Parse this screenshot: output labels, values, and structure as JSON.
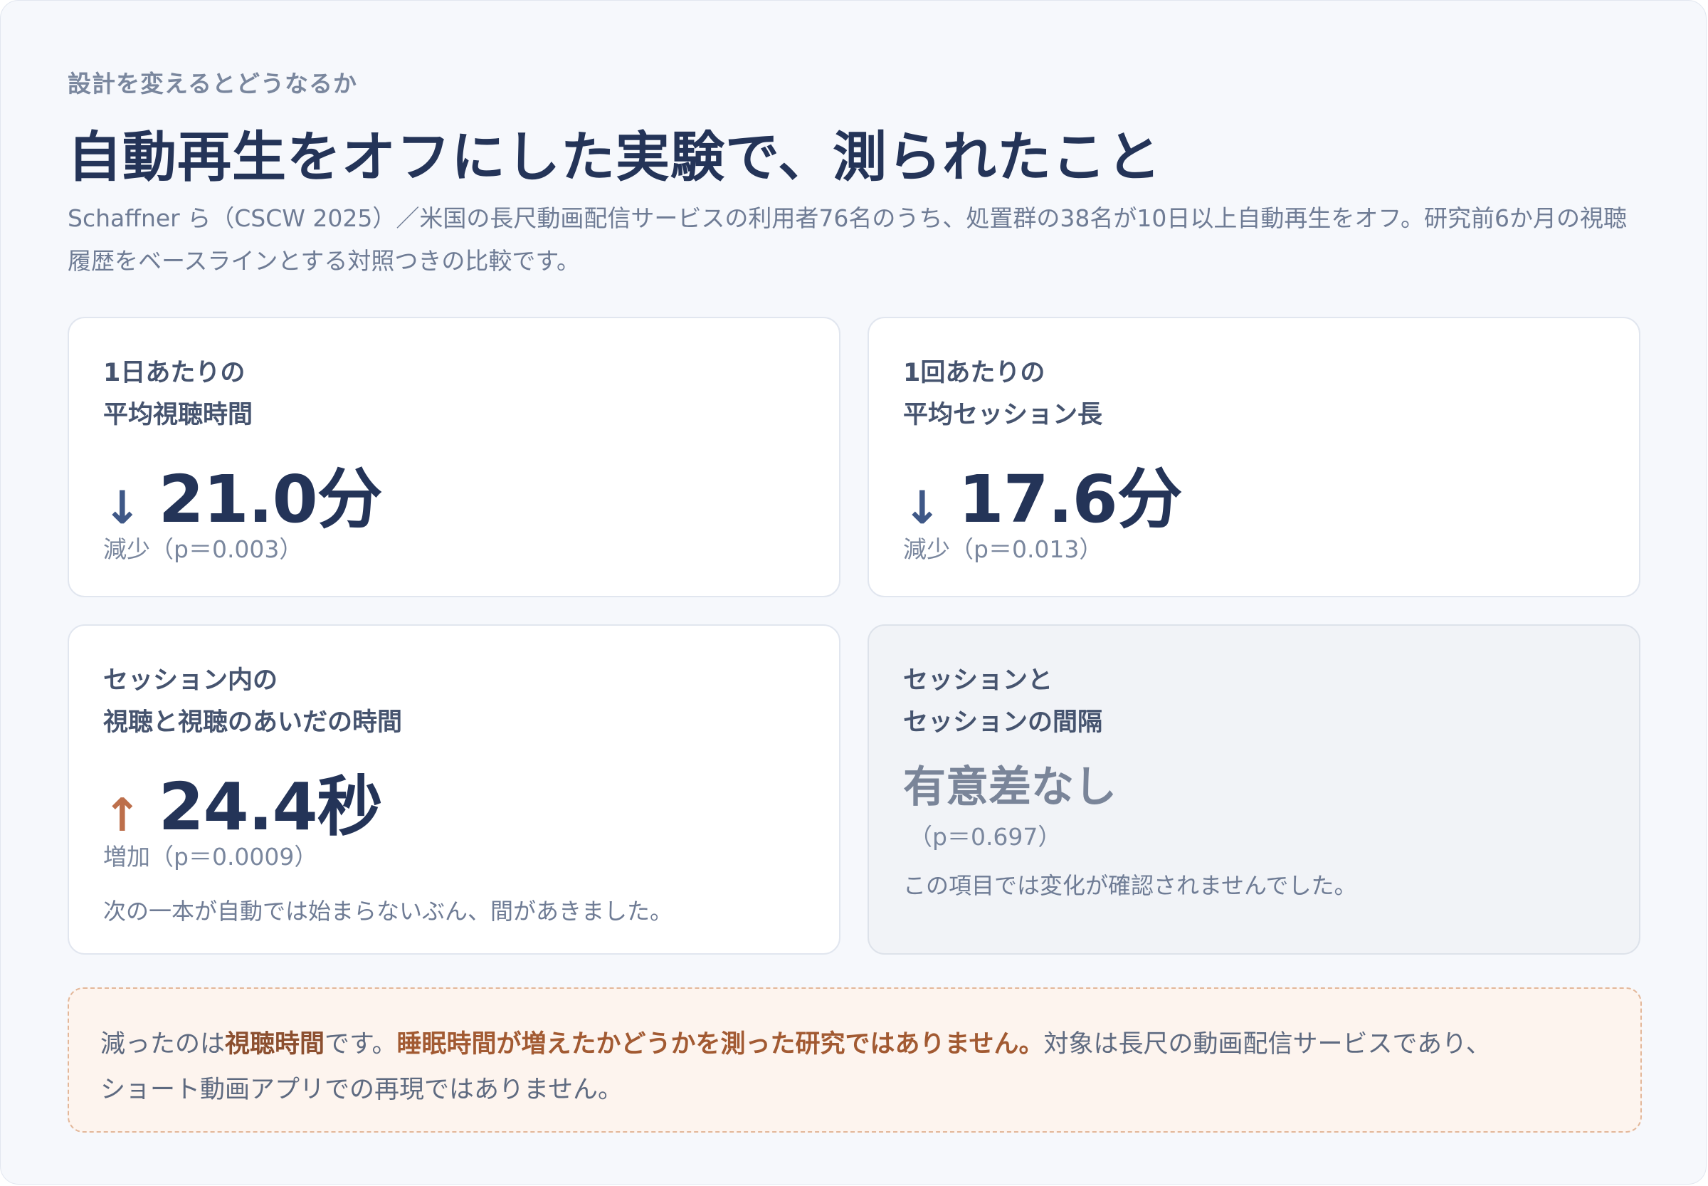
{
  "header": {
    "eyebrow": "設計を変えるとどうなるか",
    "title": "自動再生をオフにした実験で、測られたこと",
    "lead": "Schaffner ら（CSCW 2025）／米国の長尺動画配信サービスの利用者76名のうち、処置群の38名が10日以上自動再生をオフ。研究前6か月の視聴履歴をベースラインとする対照つきの比較です。"
  },
  "cards": [
    {
      "label_line1": "1日あたりの",
      "label_line2": "平均視聴時間",
      "arrow": "↓",
      "direction": "down",
      "value": "21.0分",
      "stat": "減少（p＝0.003）"
    },
    {
      "label_line1": "1回あたりの",
      "label_line2": "平均セッション長",
      "arrow": "↓",
      "direction": "down",
      "value": "17.6分",
      "stat": "減少（p＝0.013）"
    },
    {
      "label_line1": "セッション内の",
      "label_line2": "視聴と視聴のあいだの時間",
      "arrow": "↑",
      "direction": "up",
      "value": "24.4秒",
      "stat": "増加（p＝0.0009）",
      "note": "次の一本が自動では始まらないぶん、間があきました。"
    },
    {
      "label_line1": "セッションと",
      "label_line2": "セッションの間隔",
      "result": "有意差なし",
      "stat": "（p＝0.697）",
      "note": "この項目では変化が確認されませんでした。"
    }
  ],
  "callout": {
    "part1": "減ったのは",
    "part2": "視聴時間",
    "part3": "です。",
    "part4": "睡眠時間が増えたかどうかを測った研究ではありません。",
    "part5": "対象は長尺の動画配信サービスであり、",
    "part6": "ショート動画アプリでの再現ではありません。"
  },
  "colors": {
    "title": "#243458",
    "arrow_down": "#3f5887",
    "arrow_up": "#bd6f4b",
    "callout_bg": "#fdf4ee",
    "callout_accent": "#a25a32"
  }
}
